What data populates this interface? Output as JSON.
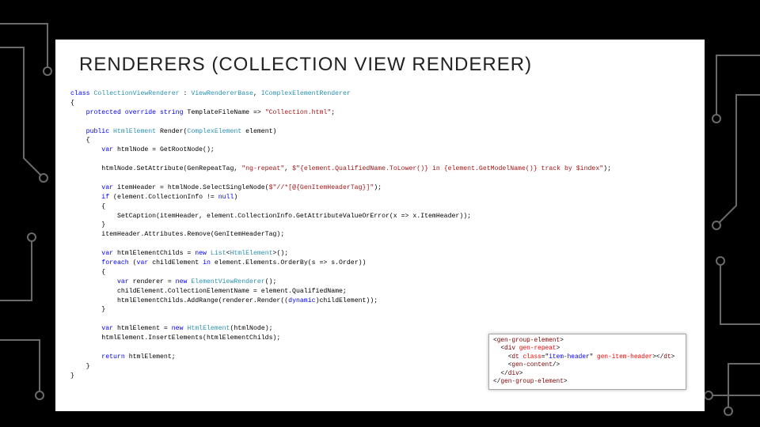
{
  "title": "RENDERERS (COLLECTION VIEW RENDERER)",
  "code": {
    "l01a": "class",
    "l01b": " CollectionViewRenderer",
    "l01c": " : ",
    "l01d": "ViewRendererBase",
    "l01e": ", ",
    "l01f": "IComplexElementRenderer",
    "l02": "{",
    "l03a": "    protected override string",
    "l03b": " TemplateFileName => ",
    "l03c": "\"Collection.html\"",
    "l03d": ";",
    "l05a": "    public",
    "l05b": " HtmlElement",
    "l05c": " Render(",
    "l05d": "ComplexElement",
    "l05e": " element)",
    "l06": "    {",
    "l07a": "        var",
    "l07b": " htmlNode = GetRootNode();",
    "l09a": "        htmlNode.SetAttribute(",
    "l09b": "GenRepeatTag",
    "l09c": ", ",
    "l09d": "\"ng-repeat\"",
    "l09e": ", ",
    "l09f": "$\"{element.QualifiedName.ToLower()} in {element.GetModelName()} track by $index\"",
    "l09g": ");",
    "l11a": "        var",
    "l11b": " itemHeader = htmlNode.SelectSingleNode(",
    "l11c": "$\"//*[@{GenItemHeaderTag}]\"",
    "l11d": ");",
    "l12a": "        if",
    "l12b": " (element.CollectionInfo != ",
    "l12c": "null",
    "l12d": ")",
    "l13": "        {",
    "l14": "            SetCaption(itemHeader, element.CollectionInfo.GetAttributeValueOrError(x => x.ItemHeader));",
    "l15": "        }",
    "l16": "        itemHeader.Attributes.Remove(GenItemHeaderTag);",
    "l18a": "        var",
    "l18b": " htmlElementChilds = ",
    "l18c": "new",
    "l18d": " List",
    "l18e": "<",
    "l18f": "HtmlElement",
    "l18g": ">();",
    "l19a": "        foreach",
    "l19b": " (",
    "l19c": "var",
    "l19d": " childElement ",
    "l19e": "in",
    "l19f": " element.Elements.OrderBy(s => s.Order))",
    "l20": "        {",
    "l21a": "            var",
    "l21b": " renderer = ",
    "l21c": "new",
    "l21d": " ElementViewRenderer",
    "l21e": "();",
    "l22": "            childElement.CollectionElementName = element.QualifiedName;",
    "l23a": "            htmlElementChilds.AddRange(renderer.Render((",
    "l23b": "dynamic",
    "l23c": ")childElement));",
    "l24": "        }",
    "l26a": "        var",
    "l26b": " htmlElement = ",
    "l26c": "new",
    "l26d": " HtmlElement",
    "l26e": "(htmlNode);",
    "l27": "        htmlElement.InsertElements(htmlElementChilds);",
    "l29a": "        return",
    "l29b": " htmlElement;",
    "l30": "    }",
    "l31": "}"
  },
  "snippet": {
    "s1a": "<",
    "s1b": "gen-group-element",
    "s1c": ">",
    "s2a": "  <",
    "s2b": "div",
    "s2c": " gen-repeat",
    "s2d": ">",
    "s3a": "    <",
    "s3b": "dt",
    "s3c": " class",
    "s3d": "=\"",
    "s3e": "item-header",
    "s3f": "\"",
    "s3g": " gen-item-header",
    "s3h": "></",
    "s3i": "dt",
    "s3j": ">",
    "s4a": "    <",
    "s4b": "gen-content",
    "s4c": "/>",
    "s5a": "  </",
    "s5b": "div",
    "s5c": ">",
    "s6a": "</",
    "s6b": "gen-group-element",
    "s6c": ">"
  }
}
